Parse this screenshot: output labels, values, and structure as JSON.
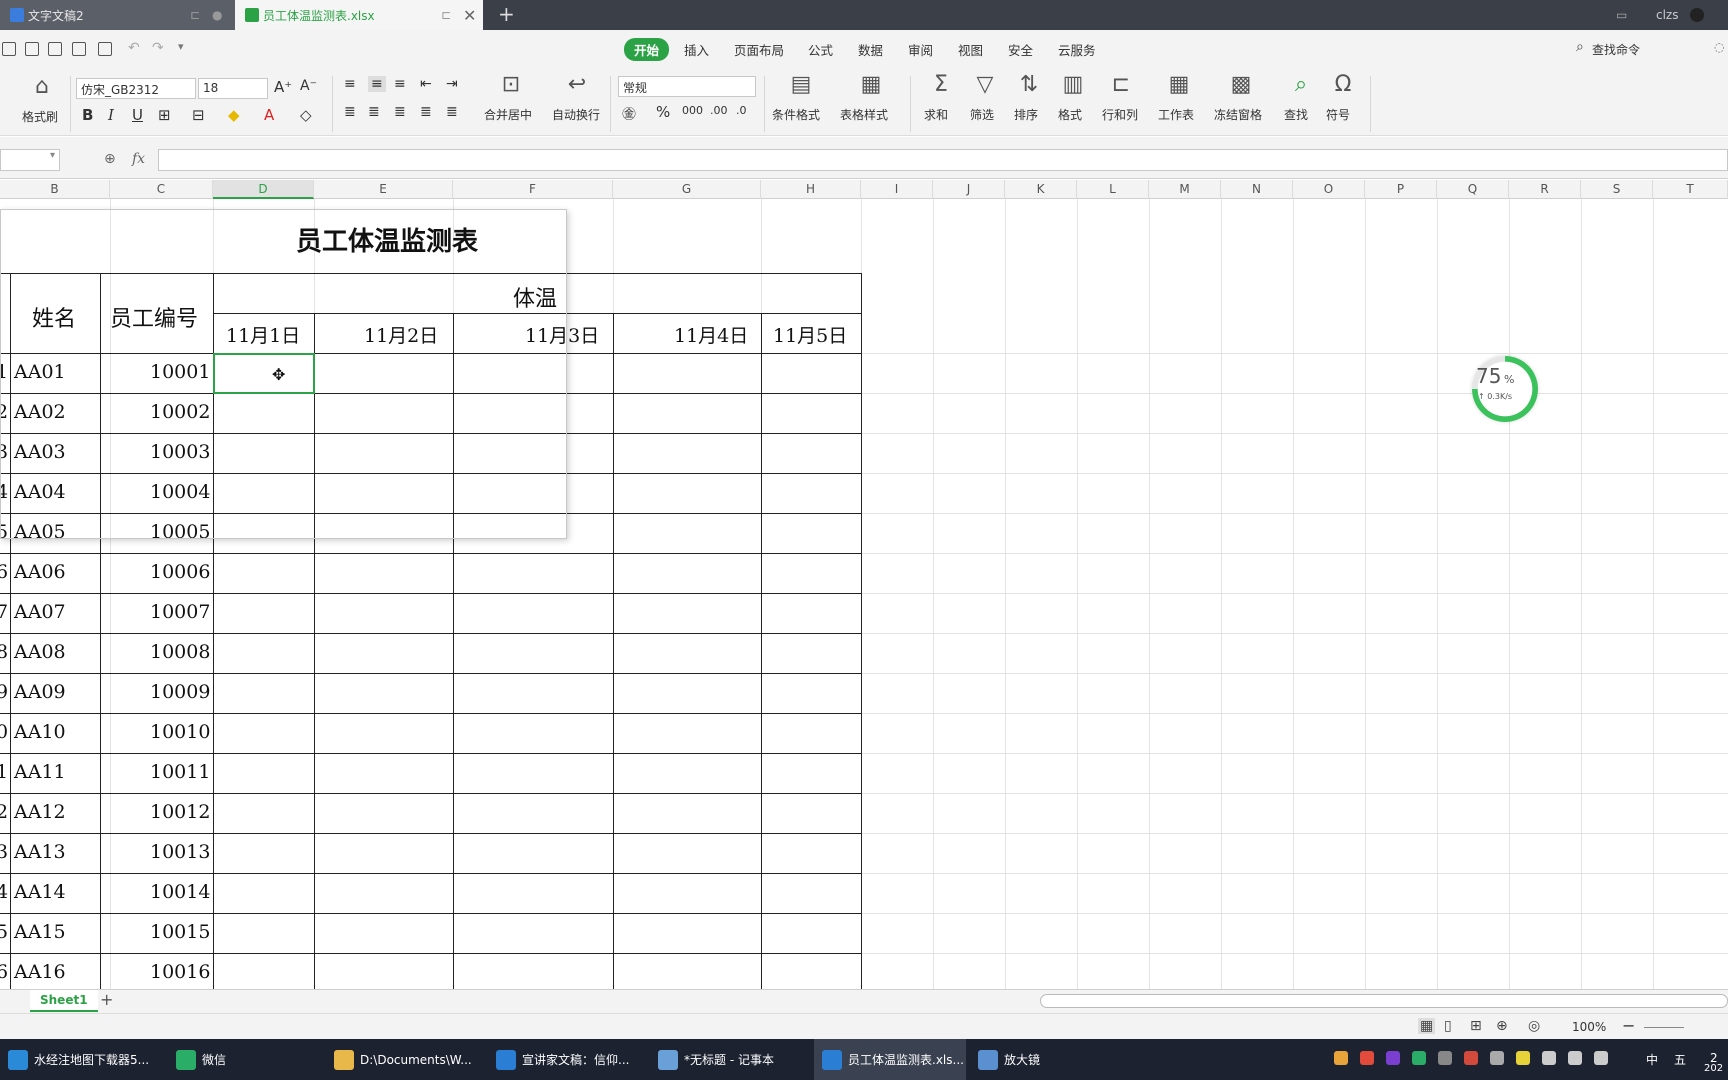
{
  "tabs": [
    {
      "label": "文字文稿2"
    },
    {
      "label": "员工体温监测表.xlsx"
    }
  ],
  "tab_new": "+",
  "user": "clzs",
  "menus": [
    "开始",
    "插入",
    "页面布局",
    "公式",
    "数据",
    "审阅",
    "视图",
    "安全",
    "云服务"
  ],
  "search_cmd": "查找命令",
  "ribbon": {
    "format_painter": "格式刷",
    "font_name": "仿宋_GB2312",
    "font_size": "18",
    "merge_center": "合并居中",
    "wrap_text": "自动换行",
    "number_format": "常规",
    "cond_format": "条件格式",
    "table_style": "表格样式",
    "sum": "求和",
    "filter": "筛选",
    "sort": "排序",
    "format": "格式",
    "row_col": "行和列",
    "worksheet": "工作表",
    "freeze": "冻结窗格",
    "find": "查找",
    "symbol": "符号",
    "bold": "B",
    "italic": "I",
    "underline": "U",
    "percent": "%"
  },
  "fx": "fx",
  "columns": [
    "B",
    "C",
    "D",
    "E",
    "F",
    "G",
    "H",
    "I",
    "J",
    "K",
    "L",
    "M",
    "N",
    "O",
    "P",
    "Q",
    "R",
    "S",
    "T"
  ],
  "sheet": {
    "title": "员工体温监测表",
    "h_name": "姓名",
    "h_id": "员工编号",
    "h_temp": "体温",
    "dates": [
      "11月1日",
      "11月2日",
      "11月3日",
      "11月4日",
      "11月5日"
    ],
    "rows": [
      {
        "idx": "1",
        "name": "AA01",
        "id": "10001"
      },
      {
        "idx": "2",
        "name": "AA02",
        "id": "10002"
      },
      {
        "idx": "3",
        "name": "AA03",
        "id": "10003"
      },
      {
        "idx": "4",
        "name": "AA04",
        "id": "10004"
      },
      {
        "idx": "5",
        "name": "AA05",
        "id": "10005"
      },
      {
        "idx": "6",
        "name": "AA06",
        "id": "10006"
      },
      {
        "idx": "7",
        "name": "AA07",
        "id": "10007"
      },
      {
        "idx": "8",
        "name": "AA08",
        "id": "10008"
      },
      {
        "idx": "9",
        "name": "AA09",
        "id": "10009"
      },
      {
        "idx": "0",
        "name": "AA10",
        "id": "10010"
      },
      {
        "idx": "1",
        "name": "AA11",
        "id": "10011"
      },
      {
        "idx": "2",
        "name": "AA12",
        "id": "10012"
      },
      {
        "idx": "3",
        "name": "AA13",
        "id": "10013"
      },
      {
        "idx": "4",
        "name": "AA14",
        "id": "10014"
      },
      {
        "idx": "5",
        "name": "AA15",
        "id": "10015"
      },
      {
        "idx": "6",
        "name": "AA16",
        "id": "10016"
      }
    ]
  },
  "sheet_tab": "Sheet1",
  "zoom": "100%",
  "gauge": {
    "value": "75",
    "unit": "%",
    "speed": "↑ 0.3K/s",
    "fraction": 0.75
  },
  "taskbar": [
    {
      "label": "水经注地图下载器5...",
      "color": "#2b8ad8"
    },
    {
      "label": "微信",
      "color": "#2aae67"
    },
    {
      "label": "D:\\Documents\\W...",
      "color": "#e8b84a"
    },
    {
      "label": "宣讲家文稿：信仰...",
      "color": "#2a7fd4"
    },
    {
      "label": "*无标题 - 记事本",
      "color": "#6aa0d8"
    },
    {
      "label": "员工体温监测表.xls...",
      "color": "#2a7fd4"
    },
    {
      "label": "放大镜",
      "color": "#5a8fd0"
    }
  ],
  "tray": {
    "ime1": "中",
    "ime2": "五",
    "time": "2",
    "date": "202"
  },
  "colors": {
    "accent": "#2ba245",
    "taskbar": "#1c2230"
  }
}
